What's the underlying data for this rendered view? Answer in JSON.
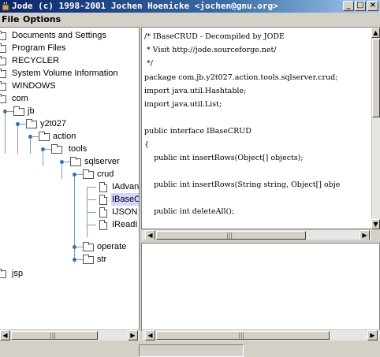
{
  "window": {
    "title": "Jode (c) 1998-2001 Jochen Hoenicke <jochen@gnu.org>",
    "buttons": {
      "minimize": "_",
      "maximize": "□",
      "close": "×"
    }
  },
  "menu": {
    "file": "File",
    "options": "Options"
  },
  "tree": {
    "items": [
      "Documents and Settings",
      "Program Files",
      "RECYCLER",
      "System Volume Information",
      "WINDOWS",
      "com",
      "jb",
      "y2t027",
      "action",
      "tools",
      "sqlserver",
      "crud",
      "IAdvan",
      "IBaseC",
      "IJSON",
      "IReadI",
      "operate",
      "str",
      "jsp"
    ]
  },
  "code": {
    "lines": [
      "/* IBaseCRUD - Decompiled by JODE",
      " * Visit http://jode.sourceforge.net/",
      " */",
      "package com.jb.y2t027.action.tools.sqlserver.crud;",
      "import java.util.Hashtable;",
      "import java.util.List;",
      "",
      "public interface IBaseCRUD",
      "{",
      "    public int insertRows(Object[] objects);",
      "",
      "    public int insertRows(String string, Object[] obje",
      "",
      "    public int deleteAll();"
    ]
  },
  "scroll": {
    "left": "◀",
    "right": "▶",
    "up": "▲",
    "down": "▼",
    "grip": "|||"
  },
  "icons": {
    "app": "coffee-cup-icon",
    "folder": "folder-icon",
    "file": "document-icon"
  }
}
